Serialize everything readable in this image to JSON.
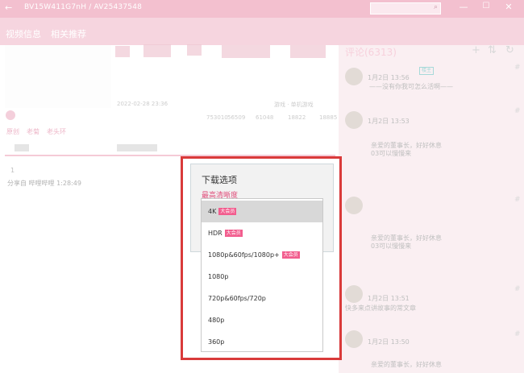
{
  "titlebar": {
    "id_text": "BV15W411G7nH / AV25437548",
    "back_icon": "←",
    "search_icon": "⌕",
    "minimize": "—",
    "maximize": "☐",
    "close": "✕"
  },
  "tabs": [
    {
      "label": "视频信息"
    },
    {
      "label": "相关推荐"
    }
  ],
  "video": {
    "date": "2022-02-28 23:36",
    "category": "游戏 · 单机游戏",
    "stats": [
      "753010",
      "56509",
      "61048",
      "18822",
      "18885"
    ],
    "tags": [
      "原创",
      "老菊",
      "老头环"
    ],
    "part_index": "1",
    "share": "分享自 哔哩哔哩 1:28:49"
  },
  "comments": {
    "title": "评论(6313)",
    "add_icon": "+",
    "sort_icon": "⇅",
    "refresh_icon": "↻",
    "hash": "#",
    "items": [
      {
        "time": "1月2日 13:56",
        "text": "——没有你我可怎么活啊——",
        "badge": "楼主"
      },
      {
        "time": "1月2日 13:53",
        "text": "亲爱的董事长，好好休息\n03可以慢慢来"
      },
      {
        "time": "",
        "text": "亲爱的董事长，好好休息\n03可以慢慢来"
      },
      {
        "time": "1月2日 13:51",
        "text": "快多来点讲故事的常文章"
      },
      {
        "time": "1月2日 13:50",
        "text": "亲爱的董事长，好好休息"
      }
    ]
  },
  "dialog": {
    "title": "下载选项",
    "subtitle": "最高清晰度",
    "options": [
      {
        "label": "4K",
        "badge": "大会员",
        "selected": true
      },
      {
        "label": "HDR",
        "badge": "大会员"
      },
      {
        "label": "1080p&60fps/1080p+",
        "badge": "大会员"
      },
      {
        "label": "1080p",
        "badge": ""
      },
      {
        "label": "720p&60fps/720p",
        "badge": ""
      },
      {
        "label": "480p",
        "badge": ""
      },
      {
        "label": "360p",
        "badge": ""
      }
    ]
  },
  "colors": {
    "accent": "#f25d8e",
    "highlight": "#d93a3a"
  }
}
